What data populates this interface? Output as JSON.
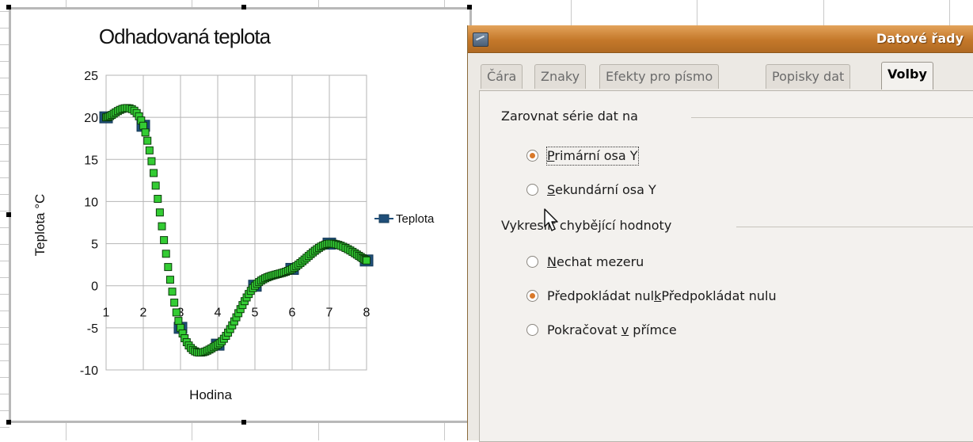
{
  "chart": {
    "title": "Odhadovaná teplota",
    "xlabel": "Hodina",
    "ylabel": "Teplota °C",
    "legend_label": "Teplota"
  },
  "chart_data": {
    "type": "line",
    "title": "Odhadovaná teplota",
    "xlabel": "Hodina",
    "ylabel": "Teplota °C",
    "x": [
      1,
      2,
      3,
      4,
      5,
      6,
      7,
      8
    ],
    "series": [
      {
        "name": "Teplota",
        "values": [
          20,
          19,
          -5,
          -7,
          0,
          2,
          5,
          3
        ]
      }
    ],
    "xlim": [
      1,
      8
    ],
    "ylim": [
      -10,
      25
    ],
    "xticks": [
      1,
      2,
      3,
      4,
      5,
      6,
      7,
      8
    ],
    "yticks": [
      -10,
      -5,
      0,
      5,
      10,
      15,
      20,
      25
    ],
    "curve": "smoothed",
    "grid": true,
    "legend": "right",
    "colors": {
      "marker": "#1f4e79",
      "line_marker": "#33cc33",
      "marker_outline": "#163a55"
    }
  },
  "dialog": {
    "title": "Datové řady",
    "tabs": [
      {
        "label": "Čára",
        "active": false
      },
      {
        "label": "Znaky",
        "active": false
      },
      {
        "label": "Efekty pro písmo",
        "active": false
      },
      {
        "label": "Popisky dat",
        "active": false
      },
      {
        "label": "Volby",
        "active": true
      }
    ],
    "align_group": {
      "title": "Zarovnat série dat na",
      "options": [
        {
          "label": "Primární osa Y",
          "checked": true
        },
        {
          "label": "Sekundární osa Y",
          "checked": false
        }
      ]
    },
    "missing_group": {
      "title": "Vykreslit chybějící hodnoty",
      "options": [
        {
          "label": "Nechat mezeru",
          "checked": false
        },
        {
          "label": "Předpokládat nulu",
          "checked": true
        },
        {
          "label": "Pokračovat v přímce",
          "checked": false
        }
      ]
    }
  }
}
